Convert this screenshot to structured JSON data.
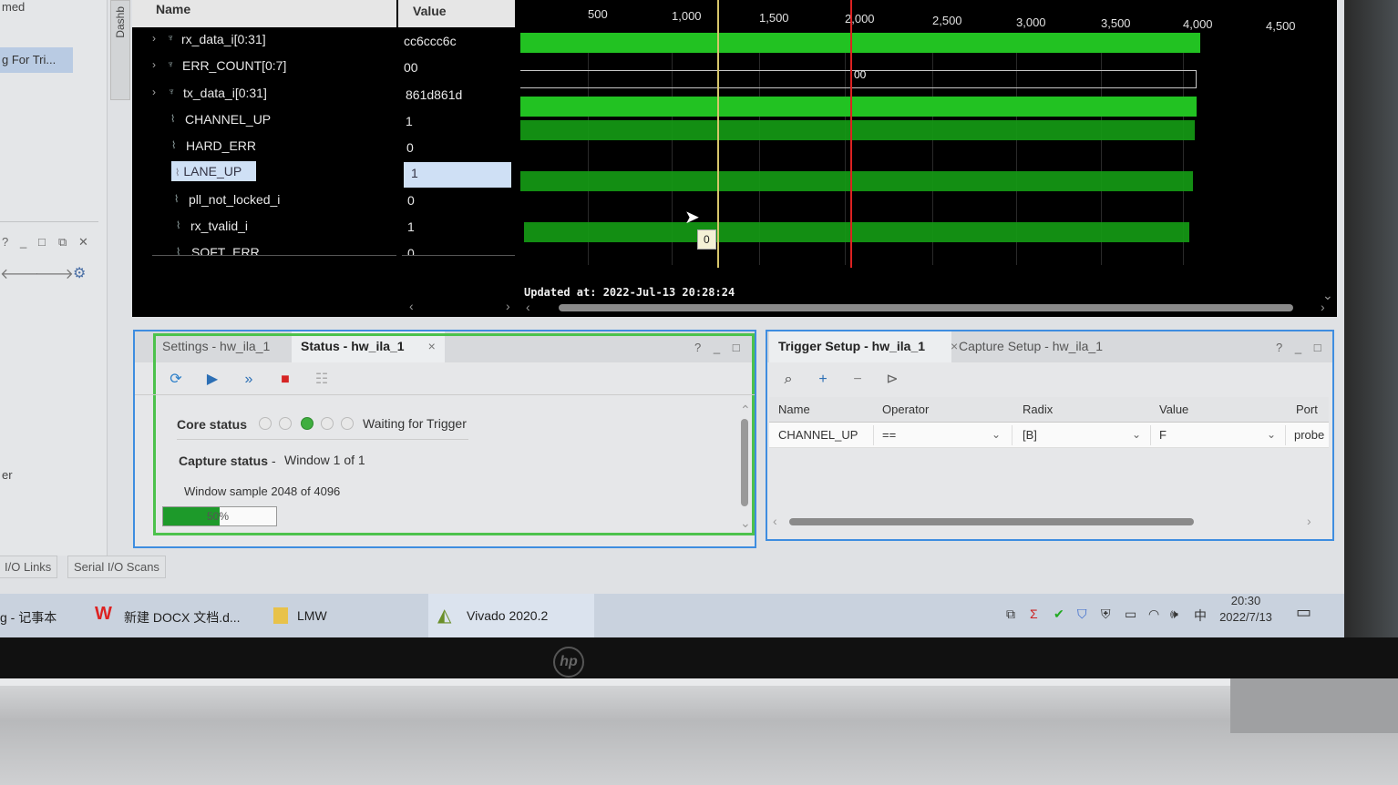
{
  "left_pane": {
    "top_text": "med",
    "highlight_item": "g For Tri...",
    "lower_text": "er",
    "vertical_tab": "Dashb"
  },
  "waveform": {
    "name_header": "Name",
    "value_header": "Value",
    "signals": [
      {
        "name": "rx_data_i[0:31]",
        "value": "cc6ccc6c",
        "type": "bus"
      },
      {
        "name": "ERR_COUNT[0:7]",
        "value": "00",
        "type": "bus"
      },
      {
        "name": "tx_data_i[0:31]",
        "value": "861d861d",
        "type": "bus"
      },
      {
        "name": "CHANNEL_UP",
        "value": "1",
        "type": "bit"
      },
      {
        "name": "HARD_ERR",
        "value": "0",
        "type": "bit"
      },
      {
        "name": "LANE_UP",
        "value": "1",
        "type": "bit",
        "selected": true
      },
      {
        "name": "pll_not_locked_i",
        "value": "0",
        "type": "bit"
      },
      {
        "name": "rx_tvalid_i",
        "value": "1",
        "type": "bit"
      },
      {
        "name": "SOFT_ERR",
        "value": "0",
        "type": "bit"
      }
    ],
    "axis_ticks": [
      "500",
      "1,000",
      "1,500",
      "2,000",
      "2,500",
      "3,000",
      "3,500",
      "4,000",
      "4,500"
    ],
    "bus_label": "00",
    "tooltip": "0",
    "updated_at": "Updated at: 2022-Jul-13 20:28:24"
  },
  "status_pane": {
    "tabs": [
      {
        "label": "Settings - hw_ila_1",
        "active": false
      },
      {
        "label": "Status - hw_ila_1",
        "active": true
      }
    ],
    "close": "×",
    "controls": [
      "?",
      "_",
      "□"
    ],
    "core_status_label": "Core status",
    "core_status_value": "Waiting for Trigger",
    "capture_status_label": "Capture status",
    "capture_status_sep": "-",
    "capture_status_value": "Window 1 of 1",
    "window_sample": "Window sample 2048 of 4096",
    "progress_text": "50%",
    "progress_fraction": 0.5
  },
  "trigger_pane": {
    "tabs": [
      {
        "label": "Trigger Setup - hw_ila_1",
        "active": true
      },
      {
        "label": "Capture Setup - hw_ila_1",
        "active": false
      }
    ],
    "close": "×",
    "controls": [
      "?",
      "_",
      "□"
    ],
    "columns": [
      "Name",
      "Operator",
      "Radix",
      "Value",
      "Port"
    ],
    "row": {
      "name": "CHANNEL_UP",
      "operator": "==",
      "radix": "[B]",
      "value": "F",
      "port": "probe"
    }
  },
  "bottom_tabs": [
    "I/O Links",
    "Serial I/O Scans"
  ],
  "taskbar": {
    "items": [
      {
        "label": "g - 记事本"
      },
      {
        "label": "新建 DOCX 文档.d..."
      },
      {
        "label": "LMW"
      },
      {
        "label": "Vivado 2020.2"
      }
    ],
    "tray_lang": "中",
    "time": "20:30",
    "date": "2022/7/13"
  },
  "colors": {
    "wave_green": "#22c222",
    "marker_red": "#dd2222",
    "marker_yellow": "#d6c56a",
    "pane_border": "#3e8de0",
    "taskbar": "#c9d2de"
  }
}
